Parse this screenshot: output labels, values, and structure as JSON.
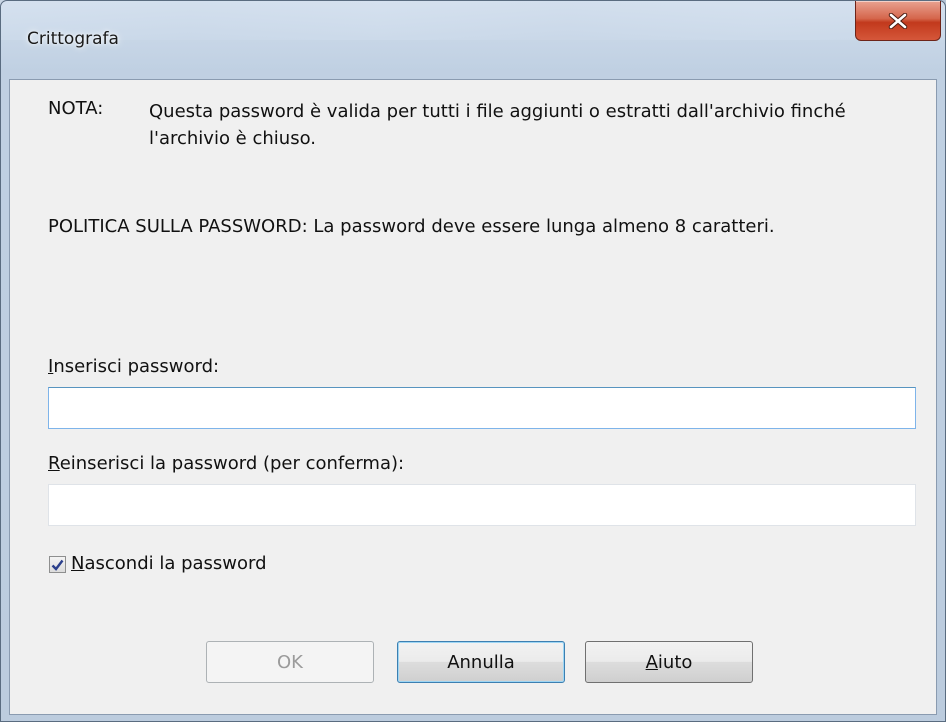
{
  "window": {
    "title": "Crittografa",
    "close_icon": "close-icon"
  },
  "note": {
    "label": "NOTA:",
    "text": "Questa password è valida per tutti i file aggiunti o estratti dall'archivio finché l'archivio è chiuso."
  },
  "policy": {
    "text": "POLITICA SULLA PASSWORD: La password deve essere lunga almeno 8 caratteri."
  },
  "fields": {
    "password_label_accel": "I",
    "password_label_rest": "nserisci password:",
    "password_value": "",
    "confirm_label_accel": "R",
    "confirm_label_rest": "einserisci la password (per conferma):",
    "confirm_value": ""
  },
  "hide_password": {
    "checked": true,
    "label_accel": "N",
    "label_rest": "ascondi la password"
  },
  "buttons": {
    "ok": "OK",
    "cancel": "Annulla",
    "help_accel": "A",
    "help_rest": "iuto"
  }
}
